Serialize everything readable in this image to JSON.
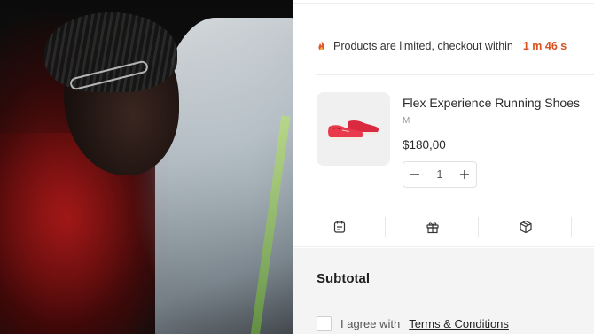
{
  "notice": {
    "text": "Products are limited, checkout within",
    "timer": "1 m 46 s",
    "icon": "fire-icon"
  },
  "product": {
    "name": "Flex Experience Running Shoes",
    "variant": "M",
    "price": "$180,00",
    "quantity": "1",
    "image_icon": "running-shoes"
  },
  "tools": [
    {
      "icon": "note-icon"
    },
    {
      "icon": "gift-icon"
    },
    {
      "icon": "box-icon"
    }
  ],
  "summary": {
    "subtotal_label": "Subtotal",
    "agree_text": "I agree with",
    "terms_link": "Terms & Conditions"
  },
  "colors": {
    "timer": "#d9531e",
    "fire": "#e2552a",
    "shoe": "#e8394d"
  }
}
